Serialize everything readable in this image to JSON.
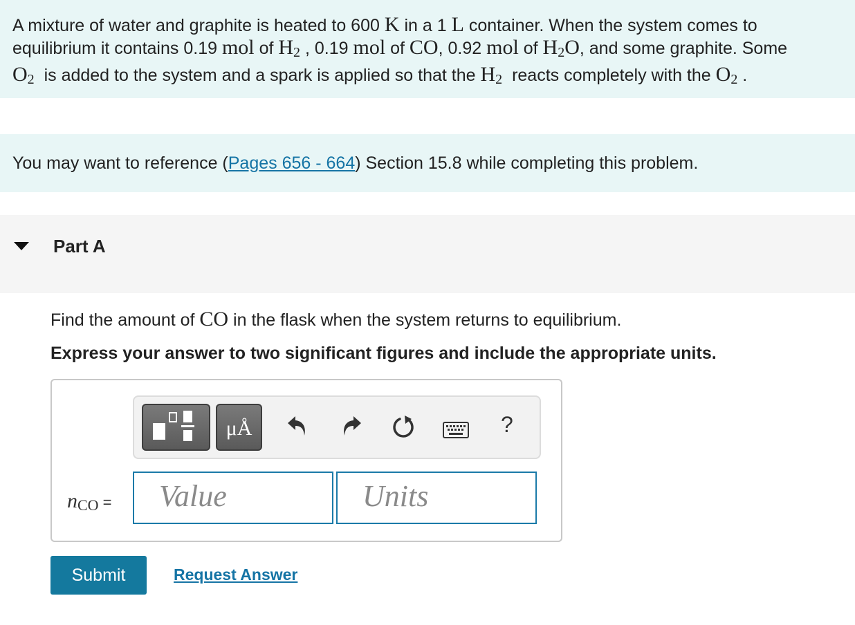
{
  "problem": {
    "line1_a": "A mixture of water and graphite is heated to 600 ",
    "line1_temp_unit": "K",
    "line1_b": " in a 1 ",
    "line1_vol_unit": "L",
    "line1_c": " container. When the system comes to",
    "line2_a": "equilibrium it contains 0.19 ",
    "line2_mol1": "mol",
    "line2_b": " of ",
    "line2_h2": "H",
    "line2_h2_sub": "2",
    "line2_c": " , 0.19 ",
    "line2_mol2": "mol",
    "line2_d": " of ",
    "line2_co": "CO",
    "line2_e": ", 0.92 ",
    "line2_mol3": "mol",
    "line2_f": " of ",
    "line2_h2o_h": "H",
    "line2_h2o_sub": "2",
    "line2_h2o_o": "O",
    "line2_g": ", and some graphite. Some",
    "line3_o2": "O",
    "line3_o2_sub": "2",
    "line3_a": "  is added to the system and a spark is applied so that the ",
    "line3_h2": "H",
    "line3_h2_sub": "2",
    "line3_b": "  reacts completely with the ",
    "line3_o2b": "O",
    "line3_o2b_sub": "2",
    "line3_c": " ."
  },
  "reference": {
    "before": "You may want to reference (",
    "link": "Pages 656 - 664",
    "after": ") Section 15.8 while completing this problem."
  },
  "part": {
    "title": "Part A"
  },
  "question": {
    "before": "Find the amount of ",
    "species": "CO",
    "after": " in the flask when the system returns to equilibrium.",
    "instruction": "Express your answer to two significant figures and include the appropriate units."
  },
  "answer": {
    "variable": "n",
    "variable_sub": "CO",
    "equals": "=",
    "symbols_button": "μÅ",
    "help": "?",
    "value_placeholder": "Value",
    "units_placeholder": "Units"
  },
  "icons": {
    "caret": "caret-down-icon",
    "templates": "templates-icon",
    "undo": "undo-icon",
    "redo": "redo-icon",
    "reset": "reset-icon",
    "keyboard": "keyboard-icon"
  },
  "actions": {
    "submit": "Submit",
    "request_answer": "Request Answer"
  },
  "colors": {
    "panel_bg": "#e8f6f6",
    "part_bg": "#f5f5f5",
    "link": "#1574a5",
    "submit_bg": "#14799e",
    "field_border": "#1a7aa8"
  }
}
